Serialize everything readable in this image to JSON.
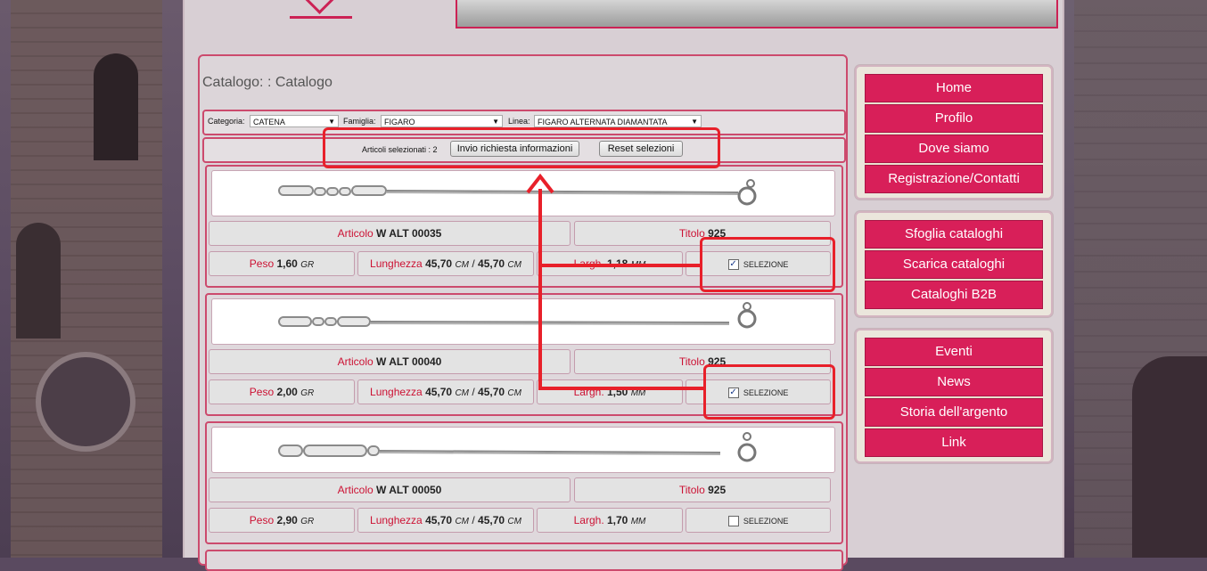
{
  "page": {
    "title": "Catalogo: : Catalogo"
  },
  "filters": {
    "category_label": "Categoria:",
    "category_value": "CATENA",
    "family_label": "Famiglia:",
    "family_value": "FIGARO",
    "line_label": "Linea:",
    "line_value": "FIGARO ALTERNATA DIAMANTATA"
  },
  "selection": {
    "count_text": "Articoli selezionati : 2",
    "send_button": "Invio richiesta informazioni",
    "reset_button": "Reset selezioni"
  },
  "product_labels": {
    "article": "Articolo",
    "title": "Titolo",
    "weight": "Peso",
    "length": "Lunghezza",
    "width": "Largh.",
    "select": "SELEZIONE",
    "unit_weight": "GR",
    "unit_length": "CM",
    "unit_width": "MM",
    "sep": "/"
  },
  "products": [
    {
      "code": "W ALT 00035",
      "title": "925",
      "weight": "1,60",
      "length_a": "45,70",
      "length_b": "45,70",
      "width": "1,18",
      "selected": true
    },
    {
      "code": "W ALT 00040",
      "title": "925",
      "weight": "2,00",
      "length_a": "45,70",
      "length_b": "45,70",
      "width": "1,50",
      "selected": true
    },
    {
      "code": "W ALT 00050",
      "title": "925",
      "weight": "2,90",
      "length_a": "45,70",
      "length_b": "45,70",
      "width": "1,70",
      "selected": false
    }
  ],
  "menu": {
    "group1": [
      "Home",
      "Profilo",
      "Dove siamo",
      "Registrazione/Contatti"
    ],
    "group2": [
      "Sfoglia cataloghi",
      "Scarica cataloghi",
      "Cataloghi B2B"
    ],
    "group3": [
      "Eventi",
      "News",
      "Storia dell'argento",
      "Link"
    ]
  },
  "colors": {
    "accent": "#cc1133",
    "menu": "#d81f59",
    "annotation": "#e8202a"
  },
  "icons": {
    "checkbox_checked": "checkbox-checked-icon",
    "dropdown": "chevron-down-icon"
  }
}
